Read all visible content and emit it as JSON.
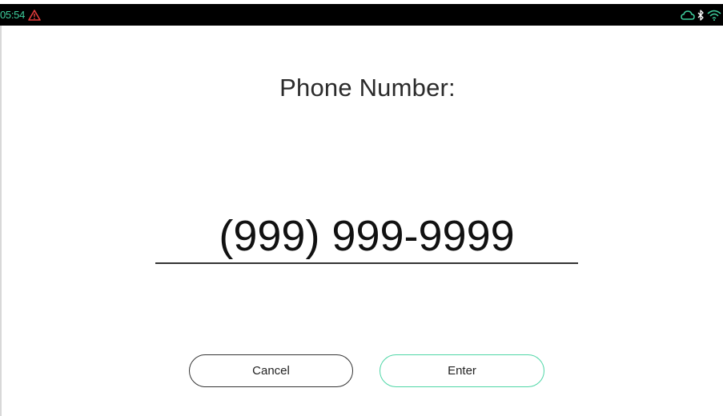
{
  "status_bar": {
    "time": "05:54",
    "icons": [
      "warning-icon",
      "cloud-icon",
      "bluetooth-icon",
      "wifi-icon"
    ],
    "colors": {
      "accent": "#3ecf9e",
      "warning": "#e23b3b",
      "background": "#000000"
    }
  },
  "form": {
    "prompt": "Phone Number:",
    "phone_placeholder": "(999) 999-9999",
    "phone_value": ""
  },
  "buttons": {
    "cancel_label": "Cancel",
    "enter_label": "Enter",
    "enter_border_color": "#4ed6a6"
  }
}
